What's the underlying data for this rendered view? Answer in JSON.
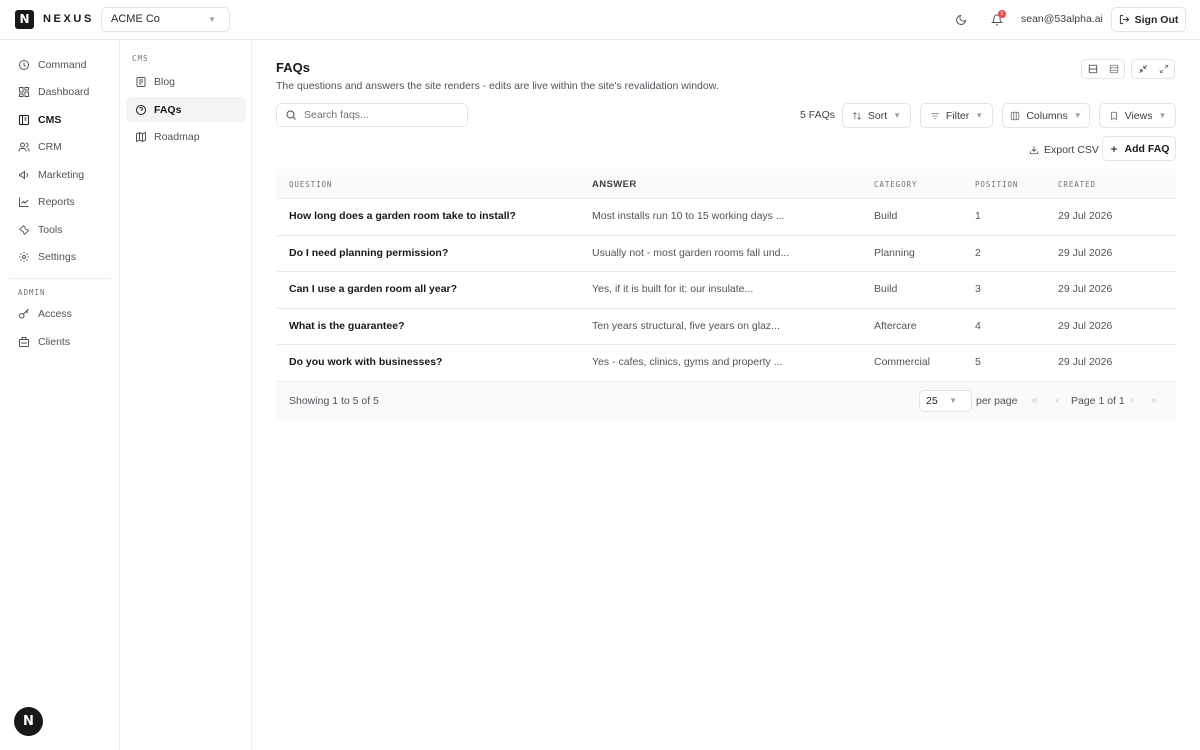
{
  "app": {
    "logo_letter": "N",
    "name": "NEXUS",
    "org": "ACME Co",
    "user_email": "sean@53alpha.ai",
    "notifications_count": "6",
    "sign_out": "Sign Out"
  },
  "sidebar": {
    "items": [
      {
        "label": "Command",
        "icon": "command-icon"
      },
      {
        "label": "Dashboard",
        "icon": "dashboard-icon"
      },
      {
        "label": "CMS",
        "icon": "cms-icon",
        "active": true
      },
      {
        "label": "CRM",
        "icon": "users-icon"
      },
      {
        "label": "Marketing",
        "icon": "megaphone-icon"
      },
      {
        "label": "Reports",
        "icon": "chart-icon"
      },
      {
        "label": "Tools",
        "icon": "wrench-icon"
      },
      {
        "label": "Settings",
        "icon": "gear-icon"
      }
    ],
    "admin_label": "ADMIN",
    "admin_items": [
      {
        "label": "Access",
        "icon": "key-icon"
      },
      {
        "label": "Clients",
        "icon": "building-icon"
      }
    ],
    "fab_letter": "N"
  },
  "subnav": {
    "label": "CMS",
    "items": [
      {
        "label": "Blog",
        "icon": "document-icon"
      },
      {
        "label": "FAQs",
        "icon": "question-icon",
        "active": true
      },
      {
        "label": "Roadmap",
        "icon": "map-icon"
      }
    ]
  },
  "page": {
    "title": "FAQs",
    "subtitle": "The questions and answers the site renders - edits are live within the site's revalidation window."
  },
  "toolbar": {
    "search_placeholder": "Search faqs...",
    "count": "5 FAQs",
    "sort": "Sort",
    "filter": "Filter",
    "columns": "Columns",
    "views": "Views",
    "export": "Export CSV",
    "add": "Add FAQ"
  },
  "table": {
    "headers": {
      "question": "QUESTION",
      "answer": "ANSWER",
      "category": "CATEGORY",
      "position": "POSITION",
      "created": "CREATED"
    },
    "rows": [
      {
        "question": "How long does a garden room take to install?",
        "answer": "Most installs run 10 to 15 working days ...",
        "category": "Build",
        "position": "1",
        "created": "29 Jul 2026"
      },
      {
        "question": "Do I need planning permission?",
        "answer": "Usually not - most garden rooms fall und...",
        "category": "Planning",
        "position": "2",
        "created": "29 Jul 2026"
      },
      {
        "question": "Can I use a garden room all year?",
        "answer": "Yes, if it is built for it: our insulate...",
        "category": "Build",
        "position": "3",
        "created": "29 Jul 2026"
      },
      {
        "question": "What is the guarantee?",
        "answer": "Ten years structural, five years on glaz...",
        "category": "Aftercare",
        "position": "4",
        "created": "29 Jul 2026"
      },
      {
        "question": "Do you work with businesses?",
        "answer": "Yes - cafes, clinics, gyms and property ...",
        "category": "Commercial",
        "position": "5",
        "created": "29 Jul 2026"
      }
    ]
  },
  "pagination": {
    "showing": "Showing 1 to 5 of 5",
    "per_page_value": "25",
    "per_page_label": "per page",
    "page_of": "Page 1 of 1"
  }
}
